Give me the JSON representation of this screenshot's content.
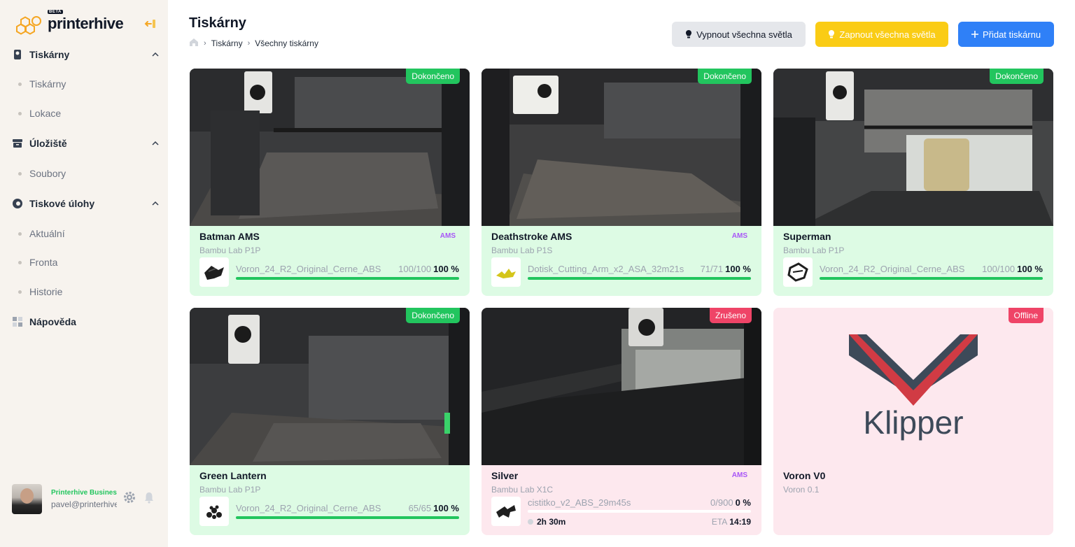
{
  "brand": {
    "name": "printerhive",
    "beta": "BETA"
  },
  "sidebar": {
    "groups": [
      {
        "label": "Tiskárny",
        "items": [
          "Tiskárny",
          "Lokace"
        ]
      },
      {
        "label": "Úložiště",
        "items": [
          "Soubory"
        ]
      },
      {
        "label": "Tiskové úlohy",
        "items": [
          "Aktuální",
          "Fronta",
          "Historie"
        ]
      },
      {
        "label": "Nápověda",
        "items": []
      }
    ],
    "user": {
      "plan": "Printerhive Business",
      "email": "pavel@printerhive.com"
    }
  },
  "header": {
    "title": "Tiskárny",
    "breadcrumb": [
      "Tiskárny",
      "Všechny tiskárny"
    ],
    "buttons": {
      "lights_off": "Vypnout všechna světla",
      "lights_on": "Zapnout všechna světla",
      "add": "Přidat tiskárnu"
    }
  },
  "printers": [
    {
      "name": "Batman AMS",
      "model": "Bambu Lab P1P",
      "status": "Dokončeno",
      "badge": "AMS",
      "file": "Voron_24_R2_Original_Cerne_ABS",
      "layers": "100/100",
      "percent": "100 %",
      "progress": 1.0
    },
    {
      "name": "Deathstroke AMS",
      "model": "Bambu Lab P1S",
      "status": "Dokončeno",
      "badge": "AMS",
      "file": "Dotisk_Cutting_Arm_x2_ASA_32m21s",
      "layers": "71/71",
      "percent": "100 %",
      "progress": 1.0
    },
    {
      "name": "Superman",
      "model": "Bambu Lab P1P",
      "status": "Dokončeno",
      "badge": "",
      "file": "Voron_24_R2_Original_Cerne_ABS",
      "layers": "100/100",
      "percent": "100 %",
      "progress": 1.0
    },
    {
      "name": "Green Lantern",
      "model": "Bambu Lab P1P",
      "status": "Dokončeno",
      "badge": "",
      "file": "Voron_24_R2_Original_Cerne_ABS",
      "layers": "65/65",
      "percent": "100 %",
      "progress": 1.0
    },
    {
      "name": "Silver",
      "model": "Bambu Lab X1C",
      "status": "Zrušeno",
      "badge": "AMS",
      "file": "cistitko_v2_ABS_29m45s",
      "layers": "0/900",
      "percent": "0 %",
      "progress": 0.0,
      "time": "2h 30m",
      "eta_label": "ETA",
      "eta": "14:19"
    },
    {
      "name": "Voron V0",
      "model": "Voron 0.1",
      "status": "Offline",
      "logo_text": "Klipper"
    }
  ],
  "colors": {
    "accent": "#2f80f7",
    "success": "#22c55e",
    "danger": "#ef4467",
    "warning": "#facc15",
    "ams": "#a855f7"
  }
}
